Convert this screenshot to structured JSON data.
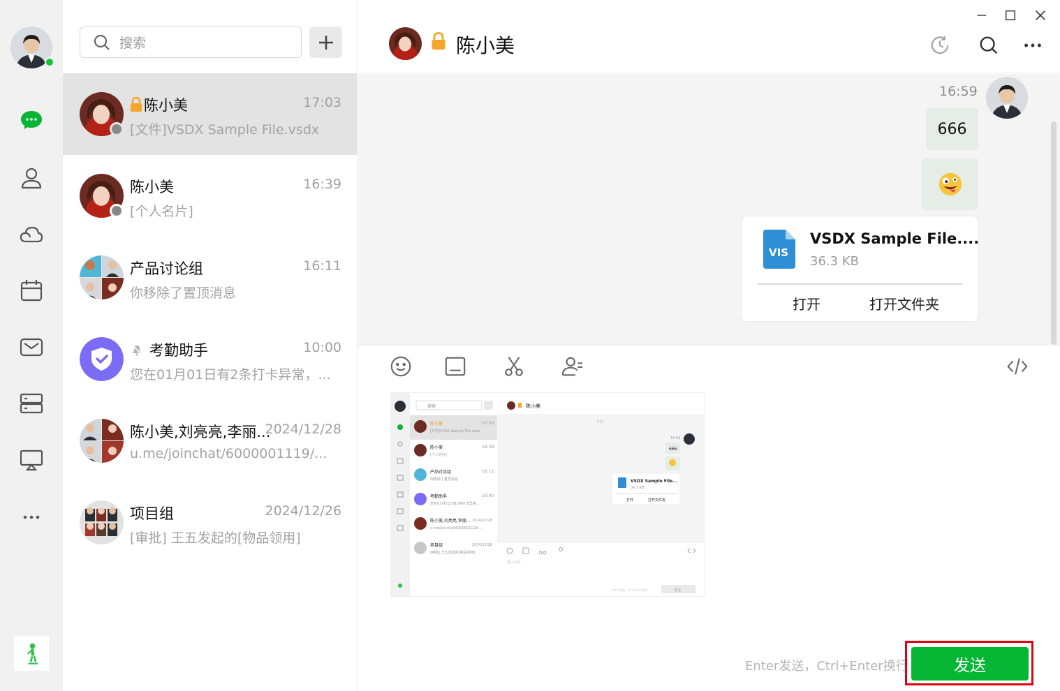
{
  "sidebar": {
    "items": [
      {
        "id": "chats",
        "icon": "chat-bubble-icon",
        "active": true
      },
      {
        "id": "contacts",
        "icon": "person-icon"
      },
      {
        "id": "cloud",
        "icon": "cloud-icon"
      },
      {
        "id": "calendar",
        "icon": "calendar-icon"
      },
      {
        "id": "mail",
        "icon": "mail-icon"
      },
      {
        "id": "apps",
        "icon": "server-icon"
      },
      {
        "id": "screen",
        "icon": "monitor-icon"
      },
      {
        "id": "more",
        "icon": "more-dots-icon"
      }
    ],
    "accent_color": "#07b534"
  },
  "search": {
    "placeholder": "搜索"
  },
  "conversations": [
    {
      "name": "陈小美",
      "time": "17:03",
      "preview": "[文件]VSDX Sample File.vsdx",
      "locked": true,
      "active": true
    },
    {
      "name": "陈小美",
      "time": "16:39",
      "preview": "[个人名片]"
    },
    {
      "name": "产品讨论组",
      "time": "16:11",
      "preview": "你移除了置顶消息"
    },
    {
      "name": "考勤助手",
      "time": "10:00",
      "preview": "您在01月01日有2条打卡异常，...",
      "muted": true
    },
    {
      "name": "陈小美,刘亮亮,李丽...",
      "time": "2024/12/28",
      "preview": "u.me/joinchat/6000001119/..."
    },
    {
      "name": "项目组",
      "time": "2024/12/26",
      "preview": "[审批] 王五发起的[物品领用]"
    }
  ],
  "chat": {
    "title": "陈小美",
    "messages": {
      "time": "16:59",
      "text": "666",
      "emoji": "zany-face",
      "file": {
        "name": "VSDX Sample File....",
        "size": "36.3 KB",
        "type_label": "VIS",
        "open_label": "打开",
        "open_folder_label": "打开文件夹"
      }
    },
    "hint": "Enter发送，Ctrl+Enter换行",
    "send_label": "发送"
  },
  "thumbnail": {
    "title": "陈小美",
    "search": "搜索",
    "date_divider": "今天",
    "msg_time": "16:59",
    "msg_text": "666",
    "file_name": "VSDX Sample File...",
    "file_size": "36.3 KB",
    "open": "打开",
    "open_folder": "打开文件夹",
    "input_placeholder": "输入消息",
    "hint": "Enter发送，Ctrl+Enter换行",
    "send": "发送",
    "rows": [
      {
        "name": "陈小美",
        "time": "17:03",
        "preview": "[文件]VSDX Sample File.vsdx"
      },
      {
        "name": "陈小美",
        "time": "16:39",
        "preview": "[个人名片]"
      },
      {
        "name": "产品讨论组",
        "time": "16:11",
        "preview": "你移除了置顶消息"
      },
      {
        "name": "考勤助手",
        "time": "10:00",
        "preview": "您在01月01日有2条打卡异常..."
      },
      {
        "name": "陈小美,刘亮亮,李丽...",
        "time": "2024/12/28",
        "preview": "u.me/joinchat/6000001119/..."
      },
      {
        "name": "项目组",
        "time": "2024/12/26",
        "preview": "[审批] 王五发起的[物品领用]"
      }
    ]
  }
}
